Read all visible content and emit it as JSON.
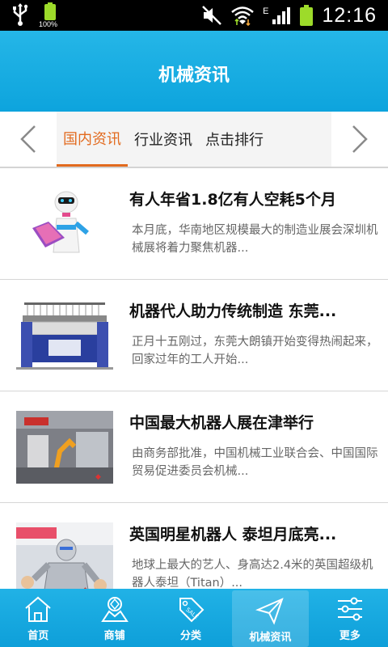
{
  "status_bar": {
    "battery_percent_label": "100%",
    "network_type": "E",
    "time": "12:16"
  },
  "header": {
    "title": "机械资讯"
  },
  "tabs": [
    {
      "label": "国内资讯",
      "active": true
    },
    {
      "label": "行业资讯",
      "active": false
    },
    {
      "label": "点击排行",
      "active": false
    }
  ],
  "news": [
    {
      "title": "有人年省1.8亿有人空耗5个月",
      "summary": "本月底，华南地区规模最大的制造业展会深圳机械展将着力聚焦机器...",
      "thumb_icon": "robot-waiter-image"
    },
    {
      "title": "机器代人助力传统制造 东莞...",
      "summary": "正月十五刚过，东莞大朗镇开始变得热闹起来，回家过年的工人开始...",
      "thumb_icon": "knitting-machine-image"
    },
    {
      "title": "中国最大机器人展在津举行",
      "summary": "由商务部批准，中国机械工业联合会、中国国际贸易促进委员会机械...",
      "thumb_icon": "robot-expo-image"
    },
    {
      "title": "英国明星机器人 泰坦月底亮...",
      "summary": "地球上最大的艺人、身高达2.4米的英国超级机器人泰坦（Titan）...",
      "thumb_icon": "titan-robot-image"
    }
  ],
  "bottom_nav": [
    {
      "label": "首页",
      "icon": "home-icon",
      "active": false
    },
    {
      "label": "商铺",
      "icon": "shop-icon",
      "active": false
    },
    {
      "label": "分类",
      "icon": "tag-icon",
      "active": false
    },
    {
      "label": "机械资讯",
      "icon": "send-icon",
      "active": true
    },
    {
      "label": "更多",
      "icon": "sliders-icon",
      "active": false
    }
  ],
  "colors": {
    "header_bg": "#0da4dd",
    "accent": "#e26a1e",
    "status_bar_bg": "#000000"
  }
}
